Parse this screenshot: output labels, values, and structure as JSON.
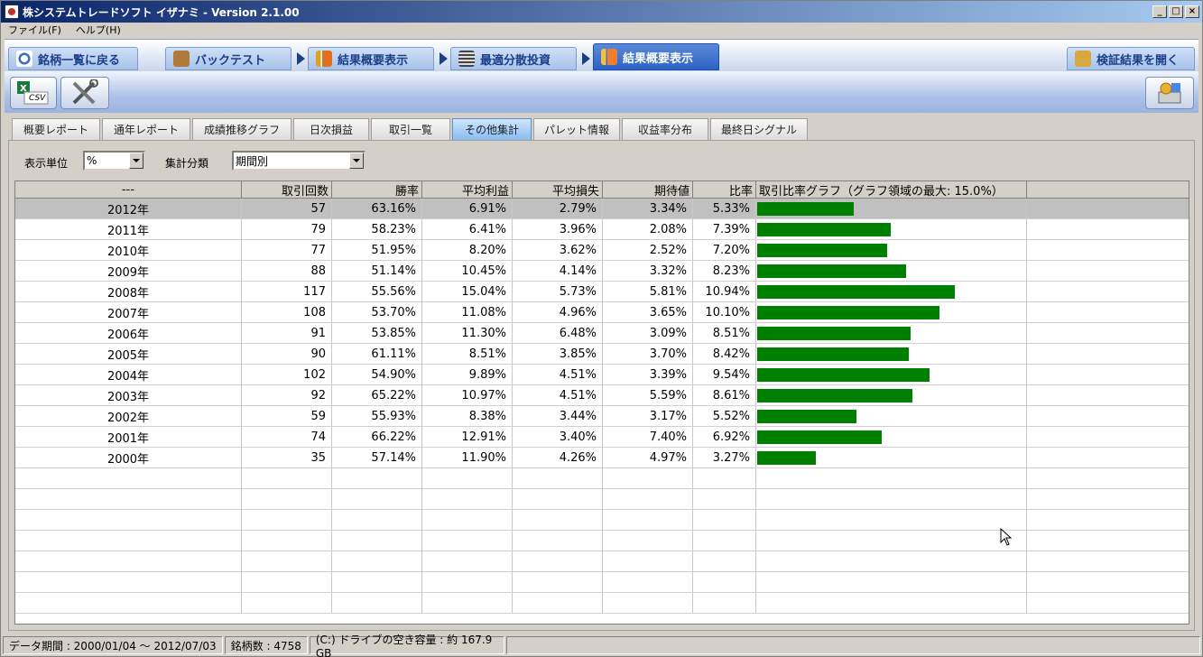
{
  "window": {
    "title": "株システムトレードソフト イザナミ - Version 2.1.00"
  },
  "menu": [
    "ファイル(F)",
    "ヘルプ(H)"
  ],
  "nav": {
    "back": "銘柄一覧に戻る",
    "steps": [
      "バックテスト",
      "結果概要表示",
      "最適分散投資",
      "結果概要表示"
    ],
    "open_results": "検証結果を開く"
  },
  "toolbar": {
    "csv_label": "CSV"
  },
  "tabs": [
    "概要レポート",
    "通年レポート",
    "成績推移グラフ",
    "日次損益",
    "取引一覧",
    "その他集計",
    "パレット情報",
    "収益率分布",
    "最終日シグナル"
  ],
  "active_tab_index": 5,
  "controls": {
    "unit_label": "表示単位",
    "unit_value": "%",
    "category_label": "集計分類",
    "category_value": "期間別"
  },
  "table": {
    "headers": [
      "---",
      "取引回数",
      "勝率",
      "平均利益",
      "平均損失",
      "期待値",
      "比率",
      "取引比率グラフ（グラフ領域の最大: 15.0%）"
    ],
    "graph_max_percent": 15.0,
    "rows": [
      {
        "period": "2012年",
        "count": "57",
        "win": "63.16%",
        "avg_profit": "6.91%",
        "avg_loss": "2.79%",
        "expect": "3.34%",
        "ratio": "5.33%",
        "ratio_value": 5.33
      },
      {
        "period": "2011年",
        "count": "79",
        "win": "58.23%",
        "avg_profit": "6.41%",
        "avg_loss": "3.96%",
        "expect": "2.08%",
        "ratio": "7.39%",
        "ratio_value": 7.39
      },
      {
        "period": "2010年",
        "count": "77",
        "win": "51.95%",
        "avg_profit": "8.20%",
        "avg_loss": "3.62%",
        "expect": "2.52%",
        "ratio": "7.20%",
        "ratio_value": 7.2
      },
      {
        "period": "2009年",
        "count": "88",
        "win": "51.14%",
        "avg_profit": "10.45%",
        "avg_loss": "4.14%",
        "expect": "3.32%",
        "ratio": "8.23%",
        "ratio_value": 8.23
      },
      {
        "period": "2008年",
        "count": "117",
        "win": "55.56%",
        "avg_profit": "15.04%",
        "avg_loss": "5.73%",
        "expect": "5.81%",
        "ratio": "10.94%",
        "ratio_value": 10.94
      },
      {
        "period": "2007年",
        "count": "108",
        "win": "53.70%",
        "avg_profit": "11.08%",
        "avg_loss": "4.96%",
        "expect": "3.65%",
        "ratio": "10.10%",
        "ratio_value": 10.1
      },
      {
        "period": "2006年",
        "count": "91",
        "win": "53.85%",
        "avg_profit": "11.30%",
        "avg_loss": "6.48%",
        "expect": "3.09%",
        "ratio": "8.51%",
        "ratio_value": 8.51
      },
      {
        "period": "2005年",
        "count": "90",
        "win": "61.11%",
        "avg_profit": "8.51%",
        "avg_loss": "3.85%",
        "expect": "3.70%",
        "ratio": "8.42%",
        "ratio_value": 8.42
      },
      {
        "period": "2004年",
        "count": "102",
        "win": "54.90%",
        "avg_profit": "9.89%",
        "avg_loss": "4.51%",
        "expect": "3.39%",
        "ratio": "9.54%",
        "ratio_value": 9.54
      },
      {
        "period": "2003年",
        "count": "92",
        "win": "65.22%",
        "avg_profit": "10.97%",
        "avg_loss": "4.51%",
        "expect": "5.59%",
        "ratio": "8.61%",
        "ratio_value": 8.61
      },
      {
        "period": "2002年",
        "count": "59",
        "win": "55.93%",
        "avg_profit": "8.38%",
        "avg_loss": "3.44%",
        "expect": "3.17%",
        "ratio": "5.52%",
        "ratio_value": 5.52
      },
      {
        "period": "2001年",
        "count": "74",
        "win": "66.22%",
        "avg_profit": "12.91%",
        "avg_loss": "3.40%",
        "expect": "7.40%",
        "ratio": "6.92%",
        "ratio_value": 6.92
      },
      {
        "period": "2000年",
        "count": "35",
        "win": "57.14%",
        "avg_profit": "11.90%",
        "avg_loss": "4.26%",
        "expect": "4.97%",
        "ratio": "3.27%",
        "ratio_value": 3.27
      }
    ],
    "empty_rows": 7
  },
  "status": {
    "data_period": "データ期間 : 2000/01/04 ～ 2012/07/03",
    "stock_count": "銘柄数 : 4758",
    "disk_space": "(C:) ドライブの空き容量 : 約 167.9 GB"
  },
  "colors": {
    "bar": "#008000",
    "selected_row": "#c0c0c0",
    "active_nav": "#2d62c4"
  }
}
